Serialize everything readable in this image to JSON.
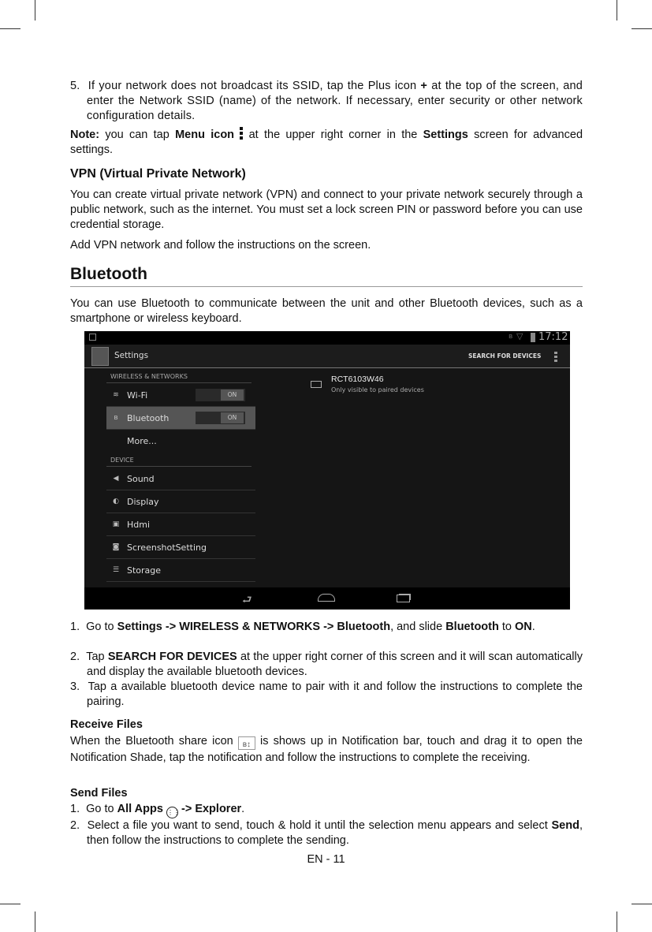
{
  "step5": {
    "num": "5.",
    "text": "If your network does not broadcast its SSID, tap the Plus icon",
    "plus": "+",
    "text2": "at the top of the screen, and enter the Network SSID (name) of the network. If necessary, enter security or other network configuration details."
  },
  "note": {
    "label": "Note:",
    "t1": "you can tap",
    "menu": "Menu icon",
    "t2": "at the upper right corner in the",
    "settings": "Settings",
    "t3": "screen for advanced settings."
  },
  "vpn": {
    "heading": "VPN (Virtual Private Network)",
    "p1": "You can create virtual private network (VPN) and connect to your private network securely through a public network, such as the internet. You must set a lock screen PIN or password before you can use credential storage.",
    "p2": "Add VPN network and follow the instructions on the screen."
  },
  "bluetooth": {
    "heading": "Bluetooth",
    "intro": "You can use Bluetooth to communicate between the unit and other Bluetooth devices, such as a smartphone or wireless keyboard."
  },
  "screenshot": {
    "time": "17:12",
    "title": "Settings",
    "search": "SEARCH FOR DEVICES",
    "cat1": "WIRELESS & NETWORKS",
    "cat2": "DEVICE",
    "items": [
      {
        "label": "Wi-Fi",
        "icon": "wifi-icon",
        "toggle": "ON"
      },
      {
        "label": "Bluetooth",
        "icon": "bluetooth-icon",
        "toggle": "ON",
        "selected": true
      },
      {
        "label": "More..."
      },
      {
        "label": "Sound",
        "icon": "speaker-icon"
      },
      {
        "label": "Display",
        "icon": "brightness-icon"
      },
      {
        "label": "Hdmi",
        "icon": "hdmi-icon"
      },
      {
        "label": "ScreenshotSetting",
        "icon": "camera-icon"
      },
      {
        "label": "Storage",
        "icon": "storage-icon"
      }
    ],
    "device_name": "RCT6103W46",
    "device_sub": "Only visible to paired devices"
  },
  "steps": [
    {
      "num": "1.",
      "a": "Go to",
      "b": "Settings -> WIRELESS & NETWORKS -> Bluetooth",
      "c": ", and slide",
      "d": "Bluetooth",
      "e": "to",
      "f": "ON",
      "g": "."
    },
    {
      "num": "2.",
      "a": "Tap",
      "b": "SEARCH FOR DEVICES",
      "c": "at the upper right corner of this screen and it will scan automatically and display the available bluetooth devices."
    },
    {
      "num": "3.",
      "a": "Tap a available bluetooth device name to pair with it and follow the instructions to complete the pairing."
    }
  ],
  "receive": {
    "heading": "Receive Files",
    "t1": "When the Bluetooth share icon",
    "t2": "is shows up in Notification bar, touch and drag it to open the Notification Shade, tap the notification and follow the instructions to complete the receiving."
  },
  "send": {
    "heading": "Send Files",
    "s1": {
      "num": "1.",
      "a": "Go to",
      "b": "All Apps",
      "c": "-> Explorer",
      "d": "."
    },
    "s2": {
      "num": "2.",
      "a": "Select a file you want to send, touch & hold it until the selection menu appears and select",
      "b": "Send",
      "c": ", then follow the instructions to complete the sending."
    }
  },
  "footer": {
    "page": "EN - 11"
  }
}
